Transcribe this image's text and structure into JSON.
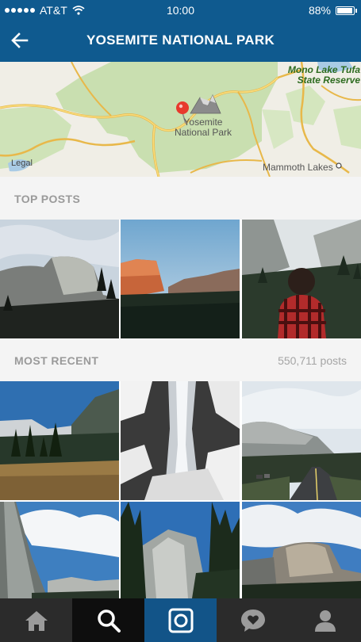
{
  "status": {
    "carrier": "AT&T",
    "time": "10:00",
    "battery": "88%",
    "battery_level": 0.88
  },
  "header": {
    "title": "YOSEMITE NATIONAL PARK",
    "back_icon": "arrow-left-icon"
  },
  "map": {
    "labels": {
      "park": "Yosemite National Park",
      "reserve": "Mono Lake Tufa State Reserve",
      "town": "Mammoth Lakes",
      "legal": "Legal"
    }
  },
  "sections": {
    "top": {
      "label": "TOP POSTS"
    },
    "recent": {
      "label": "MOST RECENT",
      "count": "550,711 posts"
    }
  },
  "photos": {
    "top": [
      "el-capitan",
      "sunset-cliffs",
      "person-in-flannel"
    ],
    "recent": [
      "meadow-trees",
      "waterfall-snow",
      "road-valley",
      "granite-wall",
      "forest-cliff",
      "el-capitan-clouds"
    ]
  },
  "tabs": [
    {
      "name": "home",
      "icon": "home-icon"
    },
    {
      "name": "search",
      "icon": "search-icon",
      "active": true
    },
    {
      "name": "camera",
      "icon": "camera-icon"
    },
    {
      "name": "activity",
      "icon": "heart-bubble-icon"
    },
    {
      "name": "profile",
      "icon": "person-icon"
    }
  ],
  "colors": {
    "header": "#0f5a8f",
    "tabbar": "#2b2b2b",
    "camera_tab": "#125488"
  }
}
